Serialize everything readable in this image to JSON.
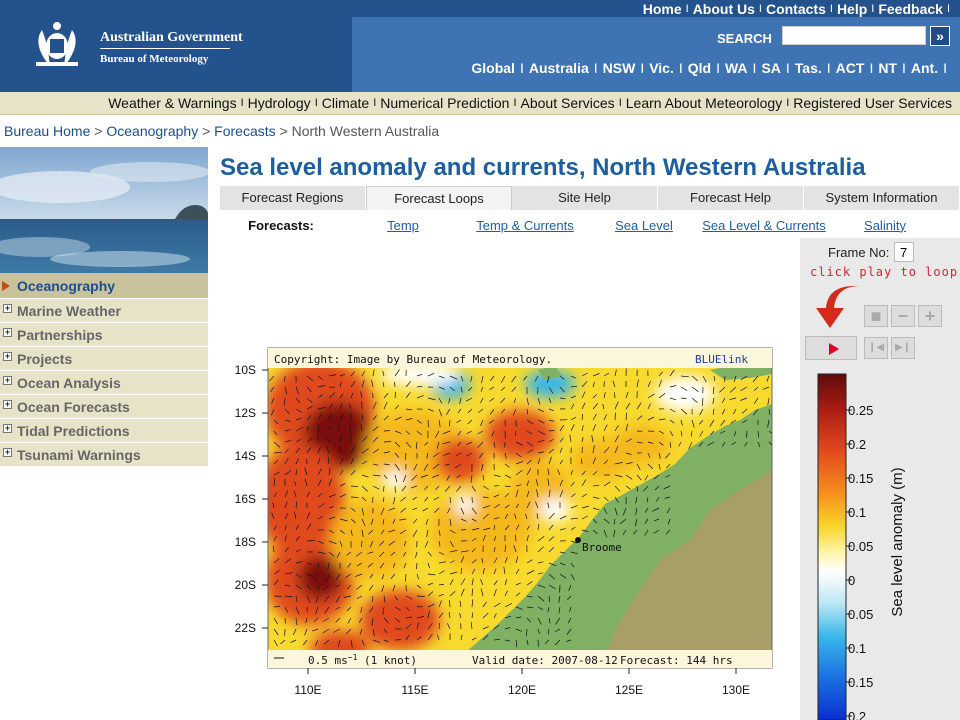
{
  "header": {
    "gov_title": "Australian Government",
    "gov_subtitle": "Bureau of Meteorology",
    "top_links": [
      "Home",
      "About Us",
      "Contacts",
      "Help",
      "Feedback"
    ],
    "search_label": "SEARCH",
    "search_value": "",
    "search_go": "»",
    "regions": [
      "Global",
      "Australia",
      "NSW",
      "Vic.",
      "Qld",
      "WA",
      "SA",
      "Tas.",
      "ACT",
      "NT",
      "Ant."
    ]
  },
  "main_nav": [
    "Weather & Warnings",
    "Hydrology",
    "Climate",
    "Numerical Prediction",
    "About Services",
    "Learn About Meteorology",
    "Registered User Services"
  ],
  "breadcrumb": {
    "items": [
      "Bureau Home",
      "Oceanography",
      "Forecasts"
    ],
    "current": "North Western Australia",
    "sep": ">"
  },
  "sidebar": {
    "active": "Oceanography",
    "items": [
      "Marine Weather",
      "Partnerships",
      "Projects",
      "Ocean Analysis",
      "Ocean Forecasts",
      "Tidal Predictions",
      "Tsunami Warnings"
    ]
  },
  "page": {
    "title": "Sea level anomaly and currents, North Western Australia"
  },
  "tabs": [
    "Forecast Regions",
    "Forecast Loops",
    "Site Help",
    "Forecast Help",
    "System Information"
  ],
  "active_tab": "Forecast Loops",
  "subtabs": {
    "label": "Forecasts:",
    "links": [
      "Temp",
      "Temp & Currents",
      "Sea Level",
      "Sea Level & Currents",
      "Salinity"
    ]
  },
  "controls": {
    "frame_label": "Frame No:",
    "frame_value": "7",
    "play_hint": "click play to loop",
    "stop": "■",
    "minus": "−",
    "plus": "+",
    "step_back": "❙◀",
    "step_fwd": "▶❙"
  },
  "chart_data": {
    "type": "heatmap",
    "copyright": "Copyright: Image by Bureau of Meteorology.",
    "brand": "BLUElink",
    "place_label": "Broome",
    "scale_text": "0.5 ms",
    "scale_suffix": " (1 knot)",
    "valid_date": "Valid date: 2007-08-12",
    "forecast": "Forecast: 144 hrs",
    "x_ticks": [
      "110E",
      "115E",
      "120E",
      "125E",
      "130E"
    ],
    "y_ticks": [
      "10S",
      "12S",
      "14S",
      "16S",
      "18S",
      "20S",
      "22S"
    ],
    "colorbar_label": "Sea level anomaly (m)",
    "colorbar_ticks": [
      "0.25",
      "0.2",
      "0.15",
      "0.1",
      "0.05",
      "0",
      "0.05",
      "0.1",
      "0.15",
      "0.2"
    ],
    "colorbar_range": [
      -0.2,
      0.3
    ],
    "colors": {
      "high": "#7a0c0c",
      "mid_high": "#e0481c",
      "warm": "#f5b81c",
      "neutral": "#ffffff",
      "cool": "#38b6ea",
      "low": "#0a2fd0",
      "land": "#7fb063",
      "land_dry": "#b59a6a"
    }
  }
}
